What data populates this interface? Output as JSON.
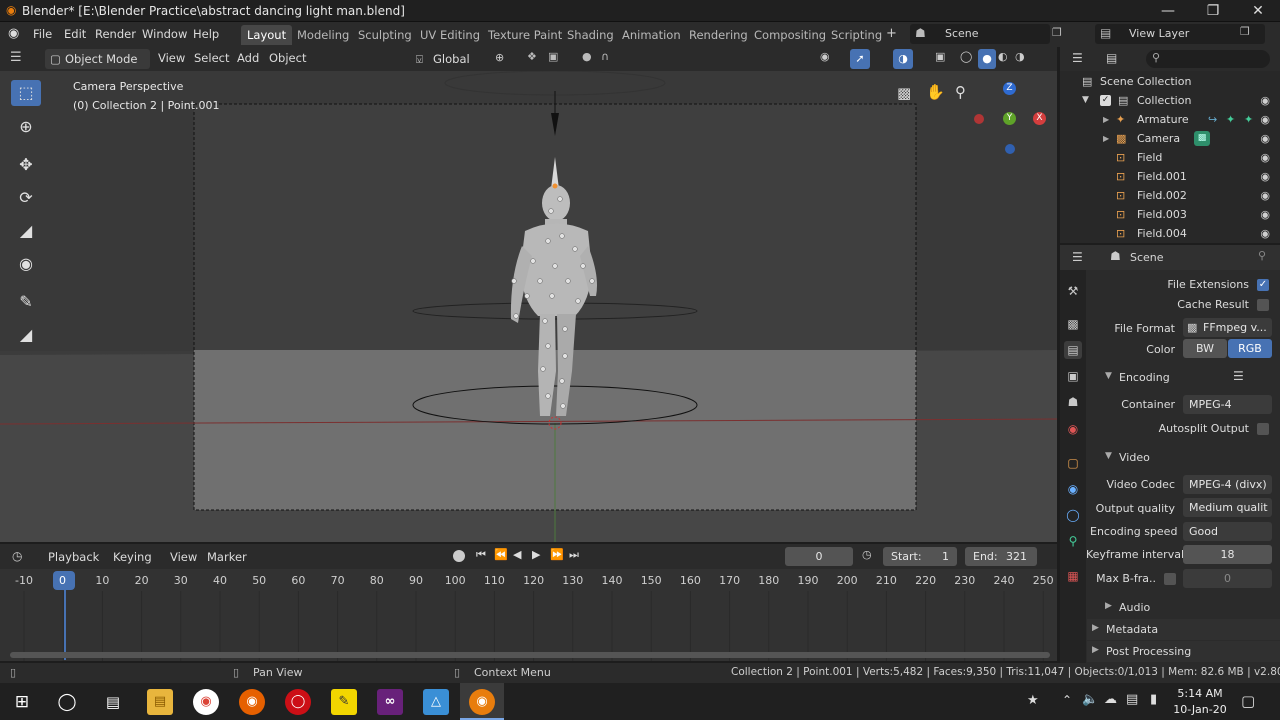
{
  "window": {
    "title": "Blender* [E:\\Blender Practice\\abstract dancing light man.blend]",
    "minimize": "—",
    "maximize": "❐",
    "close": "✕"
  },
  "menu": [
    "File",
    "Edit",
    "Render",
    "Window",
    "Help"
  ],
  "workspaces": [
    "Layout",
    "Modeling",
    "Sculpting",
    "UV Editing",
    "Texture Paint",
    "Shading",
    "Animation",
    "Rendering",
    "Compositing",
    "Scripting"
  ],
  "scene_name": "Scene",
  "view_layer": "View Layer",
  "viewport_header": {
    "mode": "Object Mode",
    "items": [
      "View",
      "Select",
      "Add",
      "Object"
    ],
    "orientation": "Global"
  },
  "viewport": {
    "line1": "Camera Perspective",
    "line2": "(0) Collection 2 | Point.001",
    "gizmo_x": "X",
    "gizmo_y": "Y",
    "gizmo_z": "Z"
  },
  "outliner": {
    "root": "Scene Collection",
    "collection": "Collection",
    "items": [
      "Armature",
      "Camera",
      "Field",
      "Field.001",
      "Field.002",
      "Field.003",
      "Field.004"
    ]
  },
  "properties": {
    "context": "Scene",
    "file_extensions": "File Extensions",
    "cache_result": "Cache Result",
    "file_format_label": "File Format",
    "file_format_value": "FFmpeg v...",
    "color_label": "Color",
    "color_bw": "BW",
    "color_rgb": "RGB",
    "encoding": "Encoding",
    "container_label": "Container",
    "container_value": "MPEG-4",
    "autosplit": "Autosplit Output",
    "video": "Video",
    "video_codec_label": "Video Codec",
    "video_codec_value": "MPEG-4 (divx)",
    "output_quality_label": "Output quality",
    "output_quality_value": "Medium qualit",
    "encoding_speed_label": "Encoding speed",
    "encoding_speed_value": "Good",
    "keyframe_label": "Keyframe interval",
    "keyframe_value": "18",
    "bframes_label": "Max B-fra..",
    "bframes_value": "0",
    "audio": "Audio",
    "metadata": "Metadata",
    "post_processing": "Post Processing"
  },
  "timeline": {
    "menus": [
      "Playback",
      "Keying",
      "View",
      "Marker"
    ],
    "current_frame": "0",
    "start_label": "Start:",
    "start": "1",
    "end_label": "End:",
    "end": "321",
    "ticks": [
      "-10",
      "0",
      "10",
      "20",
      "30",
      "40",
      "50",
      "60",
      "70",
      "80",
      "90",
      "100",
      "110",
      "120",
      "130",
      "140",
      "150",
      "160",
      "170",
      "180",
      "190",
      "200",
      "210",
      "220",
      "230",
      "240",
      "250"
    ]
  },
  "statusbar": {
    "pan": "Pan View",
    "context": "Context Menu",
    "stats": "Collection 2 | Point.001 | Verts:5,482 | Faces:9,350 | Tris:11,047 | Objects:0/1,013 | Mem: 82.6 MB | v2.80.75"
  },
  "taskbar": {
    "time": "5:14 AM",
    "date": "10-Jan-20"
  }
}
